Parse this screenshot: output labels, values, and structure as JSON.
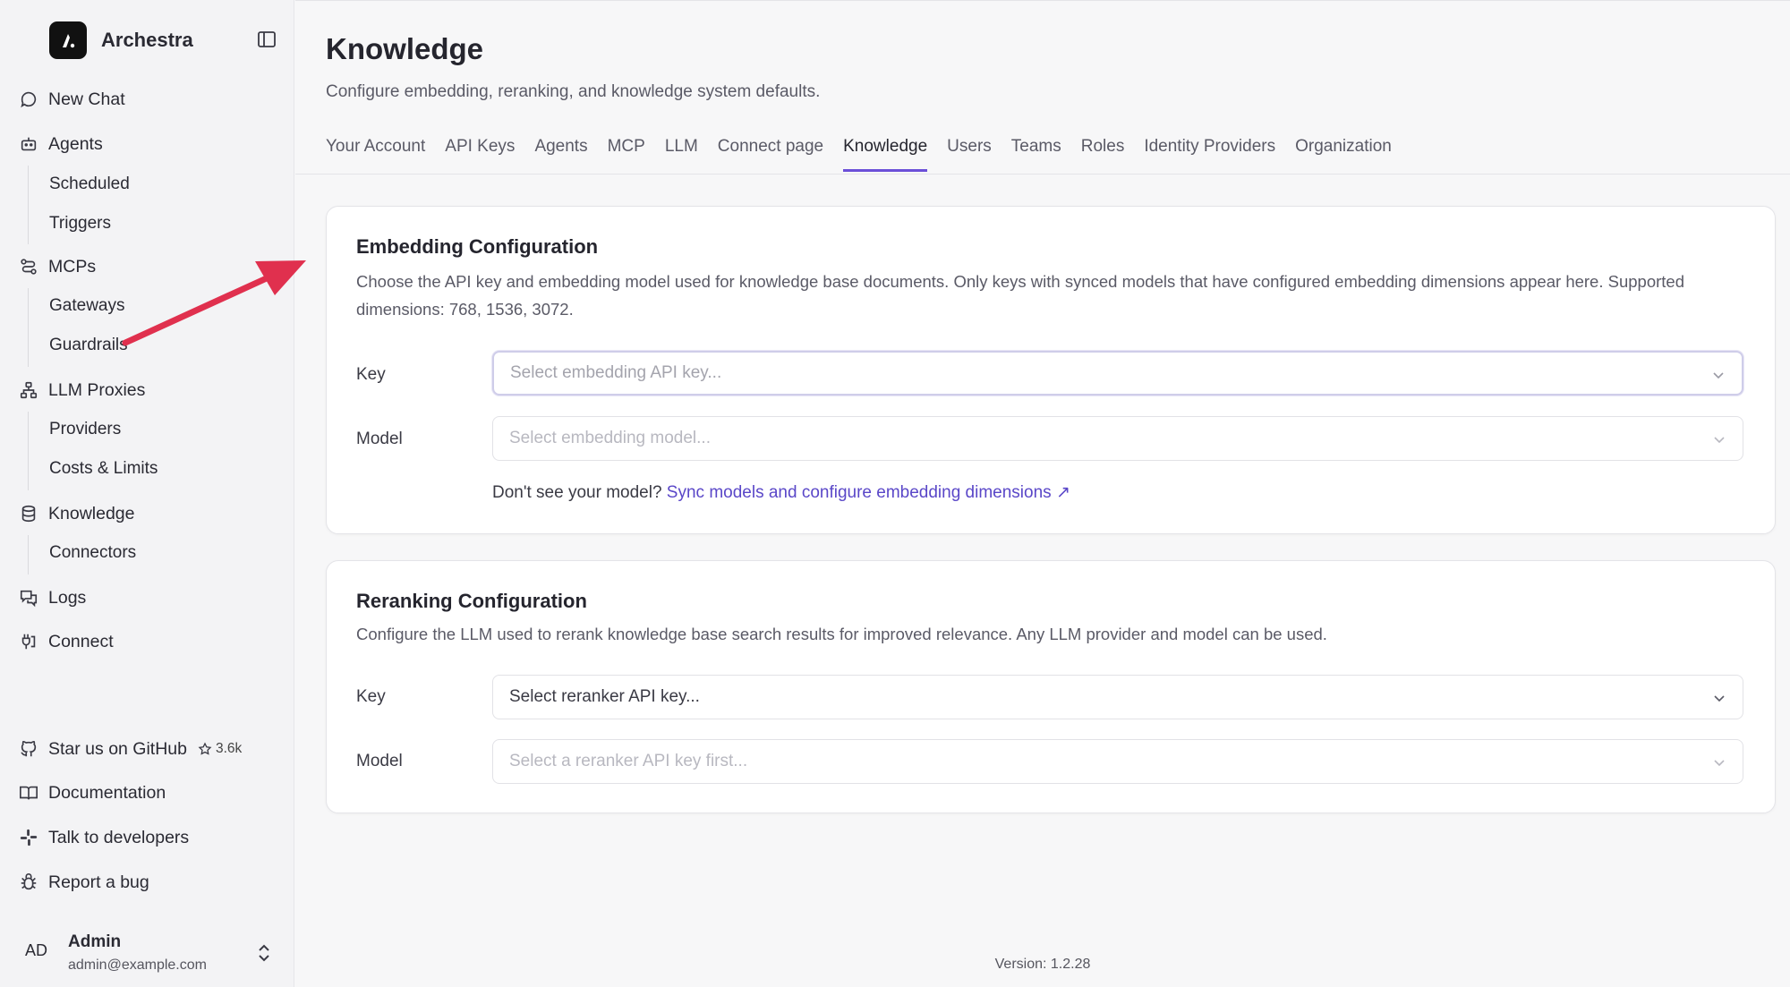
{
  "app": {
    "name": "Archestra"
  },
  "sidebar": {
    "new_chat": "New Chat",
    "agents": "Agents",
    "scheduled": "Scheduled",
    "triggers": "Triggers",
    "mcps": "MCPs",
    "gateways": "Gateways",
    "guardrails": "Guardrails",
    "llm_proxies": "LLM Proxies",
    "providers": "Providers",
    "costs_limits": "Costs & Limits",
    "knowledge": "Knowledge",
    "connectors": "Connectors",
    "logs": "Logs",
    "connect": "Connect",
    "github": "Star us on GitHub",
    "github_stars": "3.6k",
    "documentation": "Documentation",
    "talk": "Talk to developers",
    "report": "Report a bug"
  },
  "user": {
    "initials": "AD",
    "name": "Admin",
    "email": "admin@example.com"
  },
  "page": {
    "title": "Knowledge",
    "subtitle": "Configure embedding, reranking, and knowledge system defaults."
  },
  "tabs": [
    "Your Account",
    "API Keys",
    "Agents",
    "MCP",
    "LLM",
    "Connect page",
    "Knowledge",
    "Users",
    "Teams",
    "Roles",
    "Identity Providers",
    "Organization"
  ],
  "active_tab": "Knowledge",
  "embedding": {
    "title": "Embedding Configuration",
    "description": "Choose the API key and embedding model used for knowledge base documents. Only keys with synced models that have configured embedding dimensions appear here. Supported dimensions: 768, 1536, 3072.",
    "key_label": "Key",
    "key_placeholder": "Select embedding API key...",
    "model_label": "Model",
    "model_placeholder": "Select embedding model...",
    "hint_text": "Don't see your model?",
    "hint_link": "Sync models and configure embedding dimensions ↗"
  },
  "reranking": {
    "title": "Reranking Configuration",
    "description": "Configure the LLM used to rerank knowledge base search results for improved relevance. Any LLM provider and model can be used.",
    "key_label": "Key",
    "key_placeholder": "Select reranker API key...",
    "model_label": "Model",
    "model_placeholder": "Select a reranker API key first..."
  },
  "footer": {
    "version": "Version: 1.2.28"
  },
  "colors": {
    "accent": "#6b4fd8",
    "link": "#5a47c8",
    "annotation_arrow": "#e0304e"
  }
}
